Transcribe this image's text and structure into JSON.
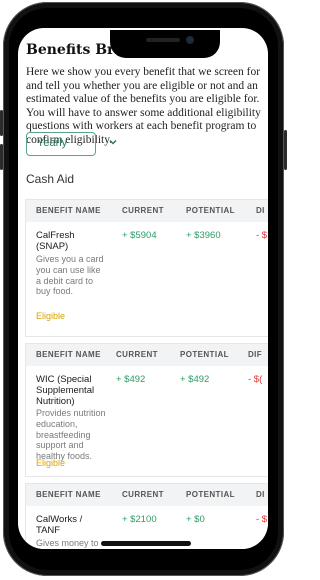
{
  "page": {
    "title": "Benefits Breakdown",
    "intro": "Here we show you every benefit that we screen for and tell you whether you are eligible or not and an estimated value of the benefits you are eligible for. You will have to answer some additional eligibility questions with workers at each benefit program to confirm eligibility.",
    "frequency": "Yearly",
    "section_title": "Cash Aid"
  },
  "table": {
    "headers": [
      "BENEFIT NAME",
      "CURRENT",
      "POTENTIAL",
      "DI"
    ],
    "headers_short": [
      "BENEFIT NAME",
      "CURRENT",
      "POTENTIAL",
      "DIF"
    ]
  },
  "benefits": [
    {
      "name": "CalFresh (SNAP)",
      "description": "Gives you a card you can use like a debit card to buy food.",
      "status": "Eligible",
      "current": "+ $5904",
      "potential": "+ $3960",
      "difference": "- $"
    },
    {
      "name": "WIC (Special Supplemental Nutrition)",
      "description": "Provides nutrition education, breastfeeding support and healthy foods.",
      "status": "Eligible",
      "current": "+ $492",
      "potential": "+ $492",
      "difference": "- $("
    },
    {
      "name": "CalWorks / TANF",
      "description": "Gives money to low-income families with",
      "status": "",
      "current": "+ $2100",
      "potential": "+ $0",
      "difference": "- $"
    }
  ],
  "colors": {
    "accent_green": "#2e9b66",
    "select_border": "#5aa58a",
    "eligible_yellow": "#d8a400",
    "negative_red": "#dd3333"
  }
}
